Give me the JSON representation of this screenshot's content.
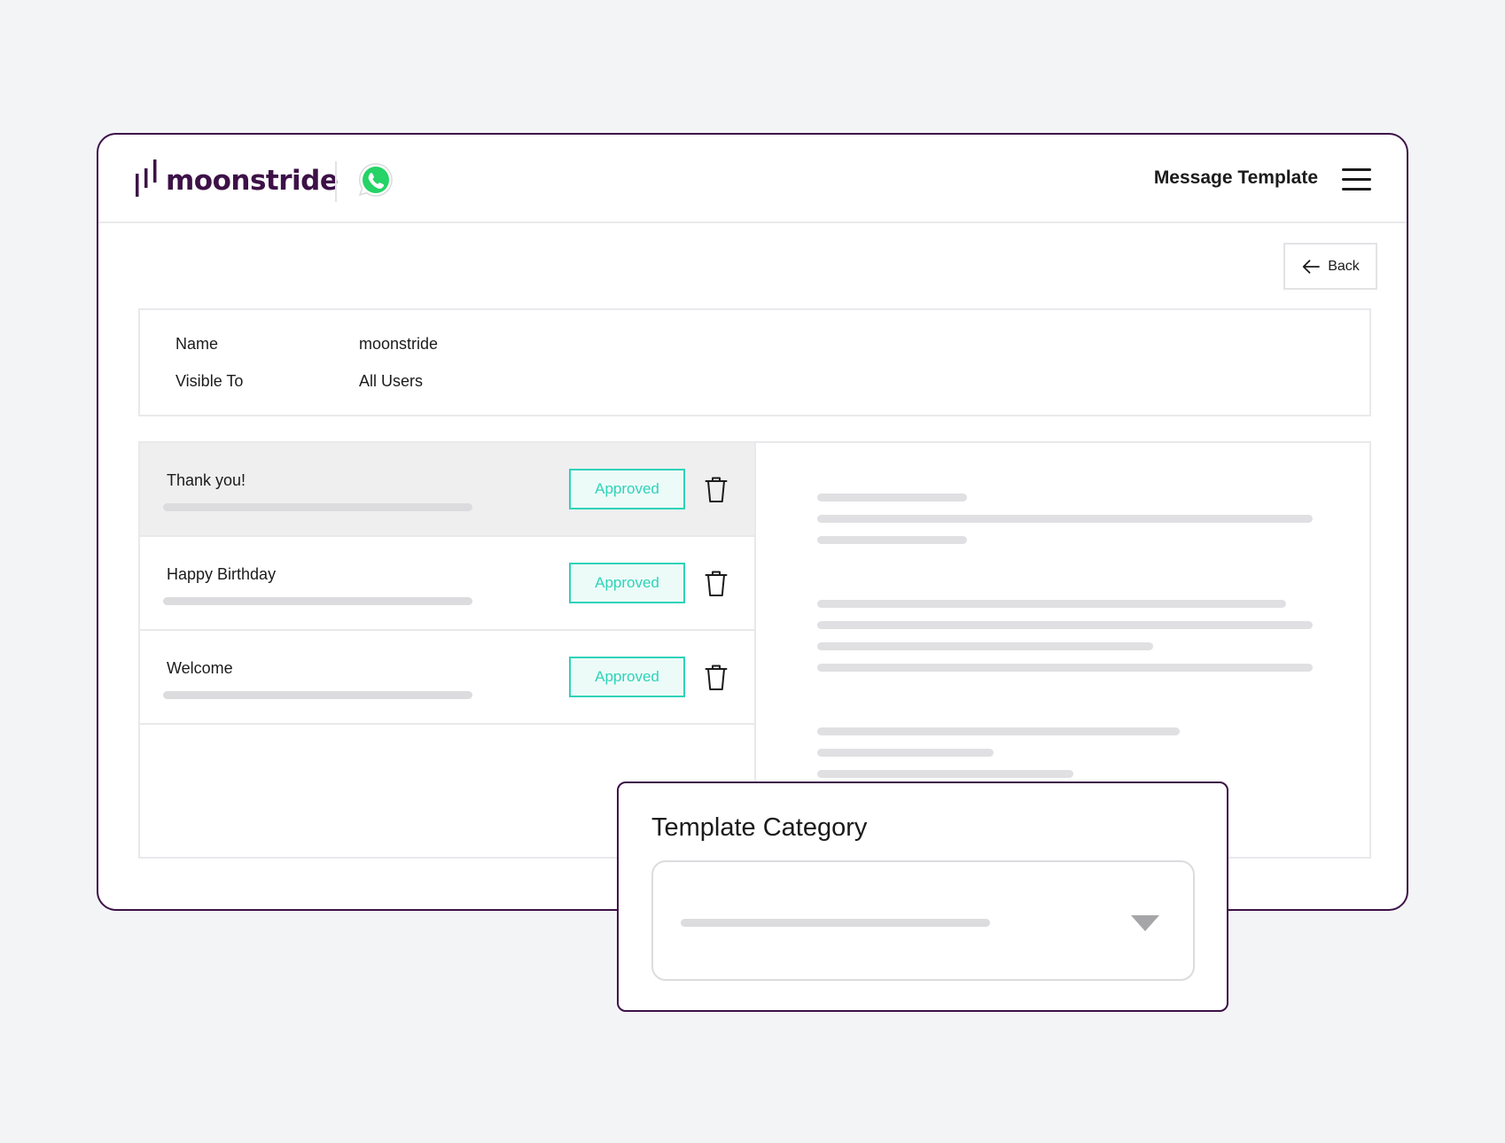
{
  "app": {
    "brand": "moonstride",
    "integration_icon": "whatsapp-icon",
    "header_title": "Message Template",
    "menu_icon": "hamburger-icon"
  },
  "toolbar": {
    "back_label": "Back",
    "back_icon": "arrow-left-icon"
  },
  "details": {
    "name_label": "Name",
    "name_value": "moonstride",
    "visible_label": "Visible To",
    "visible_value": "All Users"
  },
  "templates": [
    {
      "name": "Thank you!",
      "status": "Approved",
      "selected": true
    },
    {
      "name": "Happy Birthday",
      "status": "Approved",
      "selected": false
    },
    {
      "name": "Welcome",
      "status": "Approved",
      "selected": false
    }
  ],
  "popup": {
    "title": "Template Category",
    "dropdown_icon": "caret-down-icon"
  },
  "colors": {
    "brand_purple": "#3d1147",
    "approved_teal": "#2fd3b9",
    "whatsapp_green": "#25d366",
    "skeleton_gray": "#e0e0e3"
  }
}
